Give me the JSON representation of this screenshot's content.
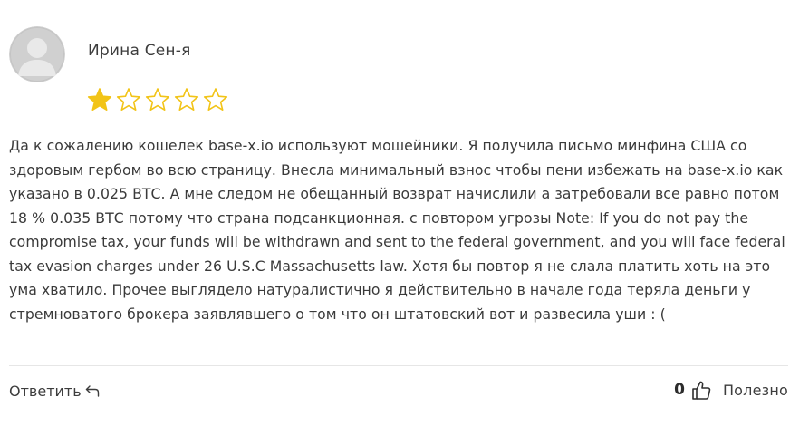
{
  "review": {
    "author": "Ирина Сен-я",
    "avatar_icon": "default-user-avatar-icon",
    "rating": 1,
    "rating_max": 5,
    "star_color": "#f2c418",
    "text": "Да к сожалению кошелек base-x.io используют мошейники. Я получила письмо минфина США со здоровым гербом во всю страницу. Внесла минимальный взнос чтобы пени избежать на base-x.io как указано в 0.025 ВТС. А мне следом не обещанный возврат начислили а затребовали все равно потом 18 % 0.035 ВТС потому что страна подсанкционная. с повтором угрозы Note: If you do not pay the compromise tax, your funds will be withdrawn and sent to the federal government, and you will face federal tax evasion charges under 26 U.S.C Massachusetts law. Хотя бы повтор я не слала платить хоть на это ума хватило. Прочее выглядело натуралистично я действительно в начале года теряла деньги у стремноватого брокера заявлявшего о том что он штатовский вот и развесила уши : ("
  },
  "actions": {
    "reply_label": "Ответить",
    "reply_icon": "reply-arrow-icon",
    "helpful_count": "0",
    "helpful_icon": "thumbs-up-icon",
    "helpful_label": "Полезно"
  }
}
